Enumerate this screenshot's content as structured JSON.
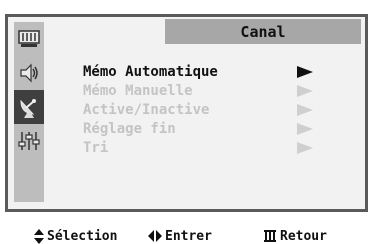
{
  "title": "Canal",
  "sidebar": {
    "icons": [
      {
        "name": "picture-icon"
      },
      {
        "name": "sound-icon"
      },
      {
        "name": "channel-antenna-icon",
        "active": true
      },
      {
        "name": "setup-sliders-icon"
      }
    ]
  },
  "menu": {
    "items": [
      {
        "label": "Mémo Automatique",
        "enabled": true
      },
      {
        "label": "Mémo Manuelle",
        "enabled": false
      },
      {
        "label": "Active/Inactive",
        "enabled": false
      },
      {
        "label": "Réglage fin",
        "enabled": false
      },
      {
        "label": "Tri",
        "enabled": false
      }
    ]
  },
  "footer": {
    "select_label": "Sélection",
    "enter_label": "Entrer",
    "return_label": "Retour",
    "select_icon": "up-down-arrows-icon",
    "enter_icon": "left-right-arrows-icon",
    "return_icon": "menu-icon"
  }
}
